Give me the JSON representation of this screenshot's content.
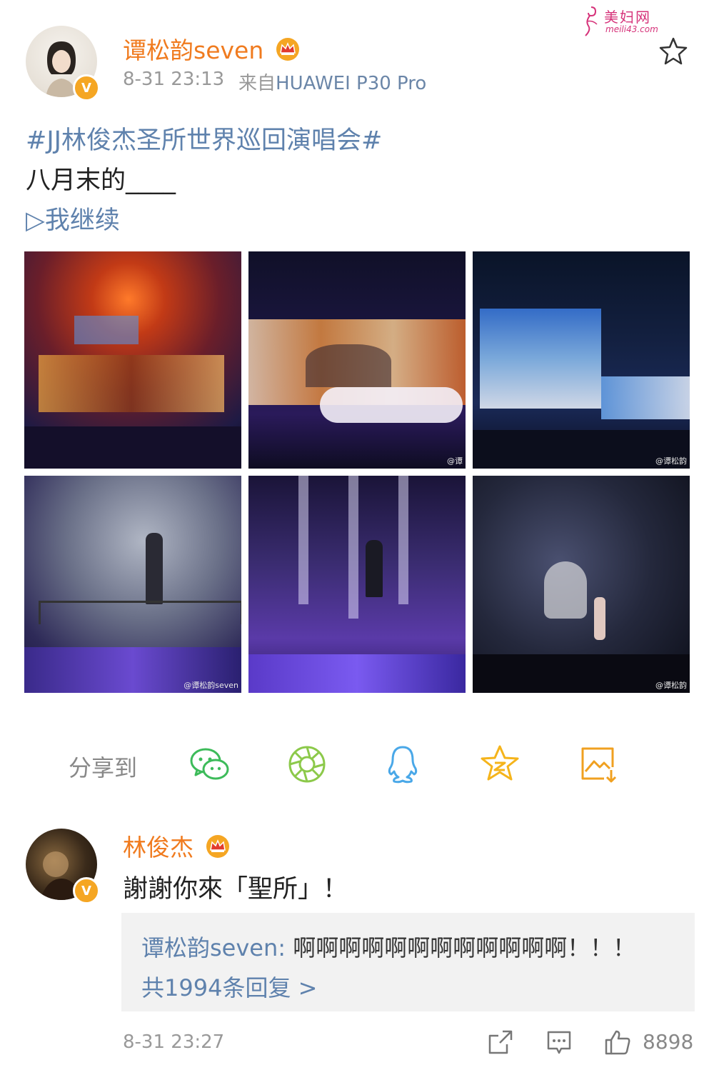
{
  "watermark": {
    "title": "美妇网",
    "url": "meili43.com"
  },
  "post": {
    "username": "谭松韵seven",
    "time": "8-31 23:13",
    "source_prefix": "来自",
    "device": "HUAWEI P30 Pro",
    "hashtag": "#JJ林俊杰圣所世界巡回演唱会#",
    "line1": "八月末的____",
    "line2": "▷我继续",
    "photo_watermarks": [
      "",
      "@谭",
      "@谭松韵",
      "@谭松韵seven",
      "",
      "@谭松韵"
    ]
  },
  "share": {
    "label": "分享到",
    "targets": [
      "wechat-icon",
      "moments-icon",
      "qq-icon",
      "qzone-icon",
      "save-image-icon"
    ]
  },
  "comment": {
    "username": "林俊杰",
    "text": "謝謝你來「聖所」！",
    "reply": {
      "user": "谭松韵seven",
      "separator": ": ",
      "text": "啊啊啊啊啊啊啊啊啊啊啊啊！！！"
    },
    "reply_count": "共1994条回复 >",
    "time": "8-31 23:27",
    "likes": "8898"
  },
  "colors": {
    "accent_orange": "#f07b1f",
    "link_blue": "#5f82ad",
    "wechat_green": "#3dbb5a",
    "moments_green": "#8cc94a",
    "qq_blue": "#4aa8e8",
    "qzone_yellow": "#f5b41b",
    "save_orange": "#f0a020"
  }
}
